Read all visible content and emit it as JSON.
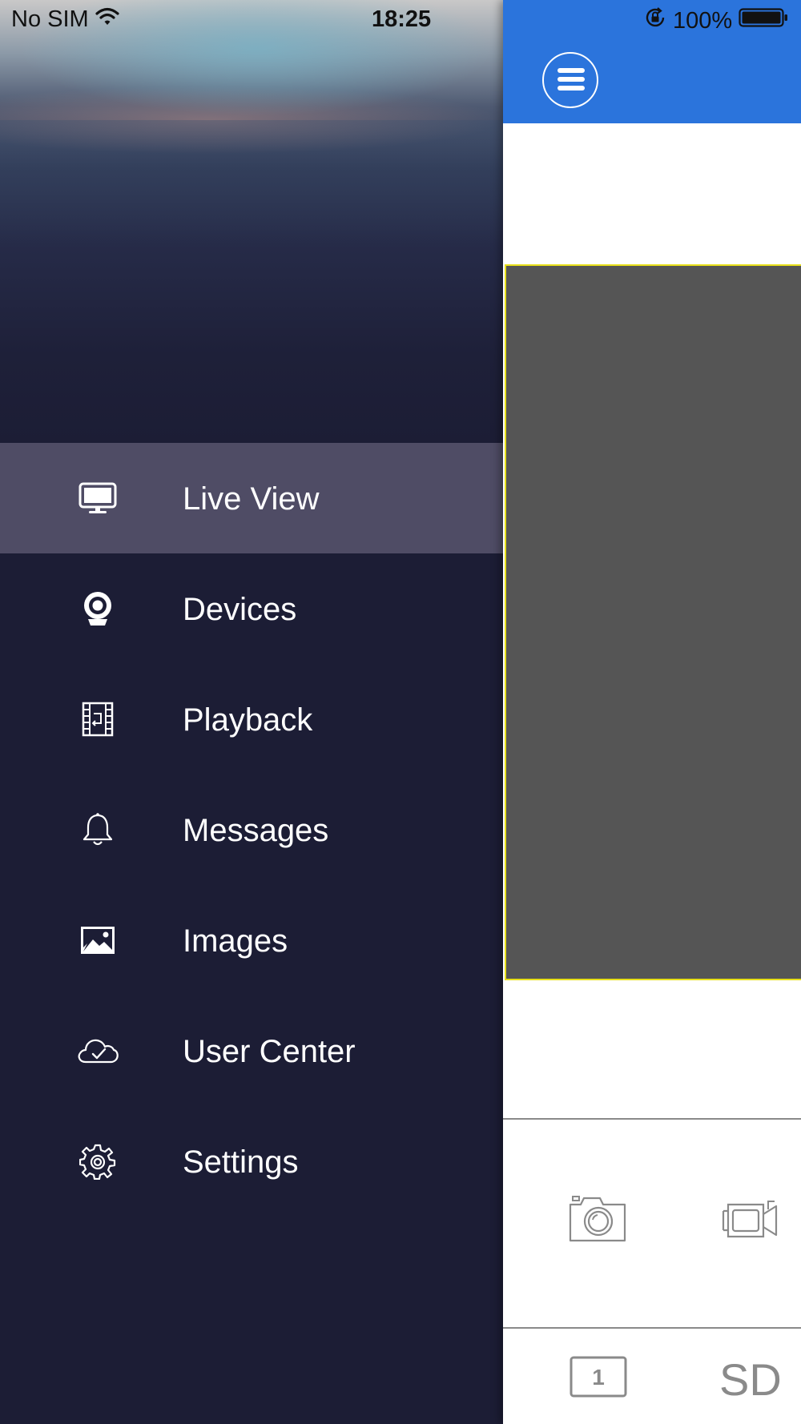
{
  "status_bar": {
    "carrier": "No SIM",
    "time": "18:25",
    "battery": "100%",
    "icons": [
      "wifi-icon",
      "orientation-lock-icon",
      "battery-icon"
    ]
  },
  "colors": {
    "drawer_bg": "#1c1d35",
    "active_item_bg": "#4f4c65",
    "topbar": "#2b74dc",
    "video_bg": "#555555",
    "video_border": "#e8e01a"
  },
  "menu": {
    "items": [
      {
        "label": "Live View",
        "icon": "monitor-icon",
        "active": true
      },
      {
        "label": "Devices",
        "icon": "camera-device-icon"
      },
      {
        "label": "Playback",
        "icon": "film-playback-icon"
      },
      {
        "label": "Messages",
        "icon": "bell-icon"
      },
      {
        "label": "Images",
        "icon": "image-icon"
      },
      {
        "label": "User Center",
        "icon": "cloud-check-icon"
      },
      {
        "label": "Settings",
        "icon": "gear-icon"
      }
    ]
  },
  "main": {
    "menu_button_icon": "hamburger-icon",
    "controls": [
      "snapshot-camera-icon",
      "record-video-icon"
    ],
    "channel_number": "1",
    "quality_label": "SD"
  }
}
